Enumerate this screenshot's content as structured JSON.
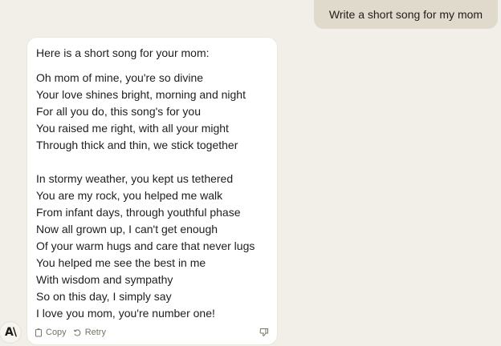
{
  "user_message": "Write a short song for my mom",
  "assistant": {
    "intro": "Here is a short song for your mom:",
    "stanzas": [
      [
        "Oh mom of mine, you're so divine",
        "Your love shines bright, morning and night",
        "For all you do, this song's for you",
        "You raised me right, with all your might",
        "Through thick and thin, we stick together"
      ],
      [
        "In stormy weather, you kept us tethered",
        "You are my rock, you helped me walk",
        "From infant days, through youthful phase",
        "Now all grown up, I can't get enough",
        "Of your warm hugs and care that never lugs",
        "You helped me see the best in me",
        "With wisdom and sympathy",
        "So on this day, I simply say",
        "I love you mom, you're number one!"
      ]
    ],
    "actions": {
      "copy_label": "Copy",
      "retry_label": "Retry"
    }
  },
  "logo_text": "A\\",
  "icons": {
    "copy": "copy-icon",
    "retry": "retry-icon",
    "thumbs_down": "thumbs-down-icon",
    "logo": "anthropic-logo"
  },
  "colors": {
    "background": "#f1efe8",
    "user_bubble": "#e0dacd",
    "card": "#ffffff",
    "muted_text": "#77736a"
  }
}
